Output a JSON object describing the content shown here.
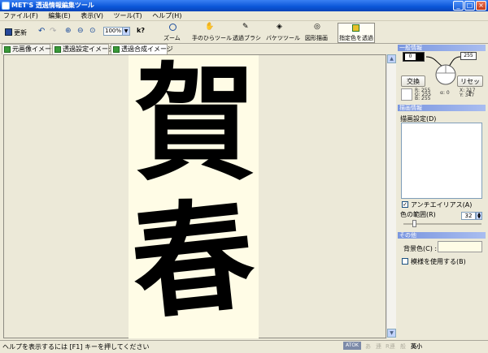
{
  "window": {
    "title": "MET'S 透過情報編集ツール",
    "min": "_",
    "max": "□",
    "close": "×"
  },
  "menu": [
    "ファイル(F)",
    "編集(E)",
    "表示(V)",
    "ツール(T)",
    "ヘルプ(H)"
  ],
  "toolbar": {
    "save_label": "更新",
    "zoom_value": "100%",
    "help_glyph": "k?",
    "buttons": [
      "ズーム",
      "手のひらツール",
      "透過ブラシ",
      "バケツツール",
      "図形描画",
      "指定色を透過"
    ]
  },
  "tabs": [
    "元画像イメージ",
    "透過設定イメージ",
    "透過合成イメージ"
  ],
  "calligraphy": {
    "top": "賀",
    "bottom": "春"
  },
  "panel": {
    "general": {
      "header": "一般情報",
      "swap_label": "交換",
      "reset_label": "リセット",
      "left_value": "0",
      "right_value": "255",
      "rgb_left": [
        "R: 255",
        "G: 255",
        "B: 255"
      ],
      "alpha_label": "α: 0",
      "xy": [
        "X: 217",
        "Y: 347"
      ]
    },
    "draw": {
      "header": "描画情報",
      "setting_label": "描画設定(D)",
      "antialias_label": "アンチエイリアス(A)",
      "color_range_label": "色の範囲(R)",
      "color_range_value": "32"
    },
    "other": {
      "header": "その他",
      "bg_color_label": "背景色(C) :",
      "pattern_label": "模様を使用する(B)"
    }
  },
  "status": {
    "text": "ヘルプを表示するには [F1] キーを押してください",
    "indicators": [
      "ATOK",
      "あ",
      "連",
      "R連",
      "般"
    ],
    "tail": "英小"
  },
  "colors": {
    "accent": "#0a55d8",
    "page_bg": "#fffce6"
  }
}
